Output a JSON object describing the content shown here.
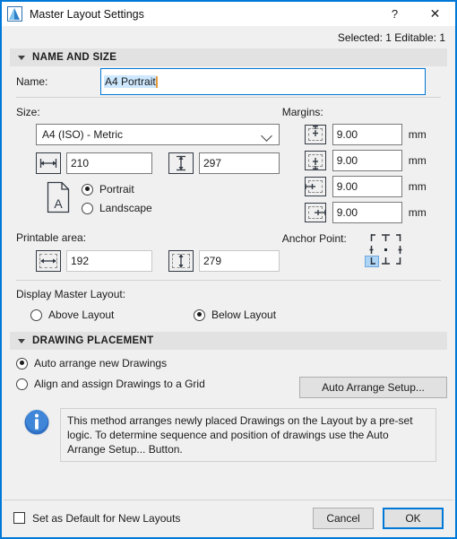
{
  "window": {
    "title": "Master Layout Settings",
    "icon": "archicad-layout-icon",
    "help_label": "?",
    "close_label": "✕",
    "status": "Selected: 1 Editable: 1"
  },
  "name_and_size": {
    "section_title": "NAME AND SIZE",
    "name_label": "Name:",
    "name_value": "A4 Portrait",
    "size_label": "Size:",
    "size_preset": "A4 (ISO) - Metric",
    "width_value": "210",
    "height_value": "297",
    "orientation": {
      "portrait_label": "Portrait",
      "landscape_label": "Landscape",
      "selected": "Portrait",
      "page_icon_letter": "A"
    },
    "margins_label": "Margins:",
    "margins": [
      {
        "icon": "margin-top-icon",
        "value": "9.00",
        "unit": "mm"
      },
      {
        "icon": "margin-bottom-icon",
        "value": "9.00",
        "unit": "mm"
      },
      {
        "icon": "margin-left-icon",
        "value": "9.00",
        "unit": "mm"
      },
      {
        "icon": "margin-right-icon",
        "value": "9.00",
        "unit": "mm"
      }
    ],
    "printable_area_label": "Printable area:",
    "printable_width": "192",
    "printable_height": "279",
    "anchor_label": "Anchor Point:",
    "anchor_selected": "bottom-left"
  },
  "display_master": {
    "label": "Display Master Layout:",
    "above_label": "Above Layout",
    "below_label": "Below Layout",
    "selected": "Below Layout"
  },
  "drawing_placement": {
    "section_title": "DRAWING PLACEMENT",
    "auto_arrange_label": "Auto arrange new Drawings",
    "align_grid_label": "Align and assign Drawings to a Grid",
    "selected": "Auto arrange new Drawings",
    "setup_button": "Auto Arrange Setup...",
    "info_icon": "info-icon",
    "info_text": "This method arranges newly placed Drawings on the Layout by a pre-set logic. To determine sequence and position of drawings use the Auto Arrange Setup... Button."
  },
  "footer": {
    "default_checkbox_label": "Set as Default for New Layouts",
    "default_checked": false,
    "cancel_label": "Cancel",
    "ok_label": "OK"
  },
  "colors": {
    "accent": "#0078d7",
    "selection": "#cde8ff",
    "caret": "#e59a3c",
    "anchor_selected": "#aed4f5",
    "section_header_bg": "#e2e2e2"
  }
}
